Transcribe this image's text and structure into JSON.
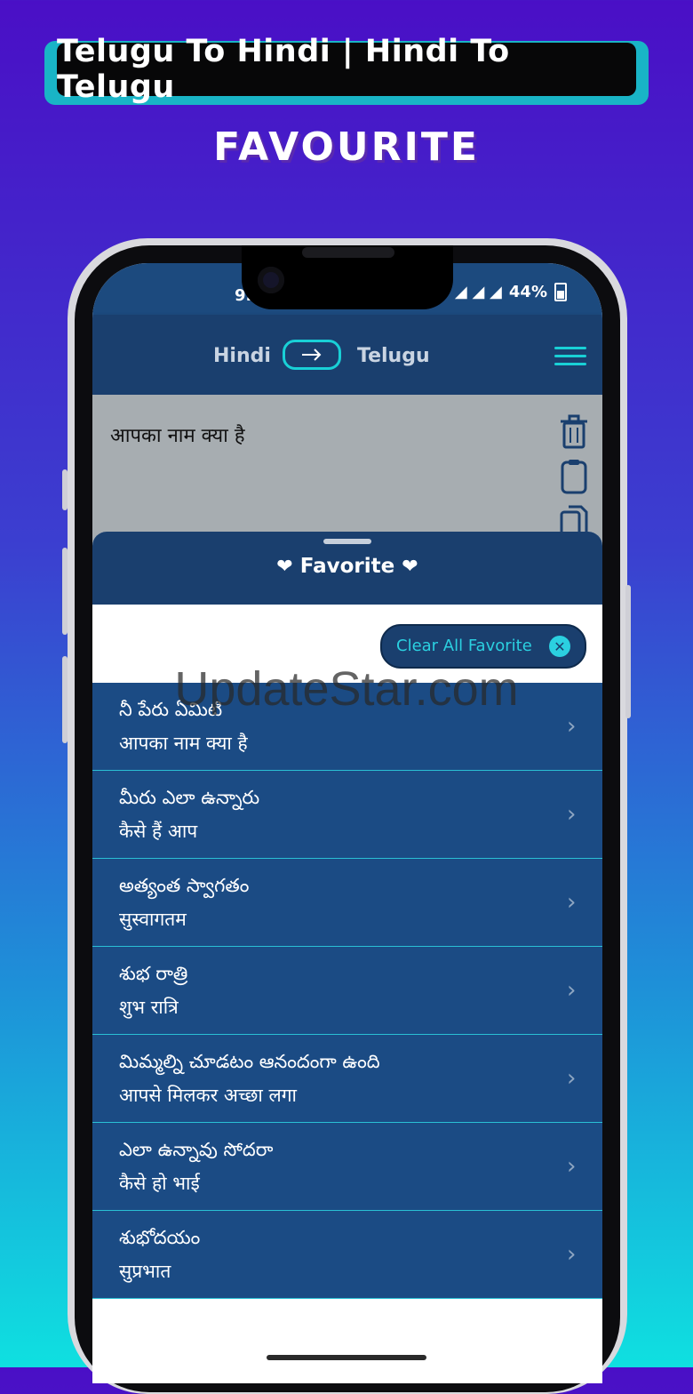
{
  "banner": {
    "title": "Telugu To Hindi | Hindi To Telugu"
  },
  "heading": "FAVOURITE",
  "status_bar": {
    "time": "9.",
    "battery": "44%"
  },
  "app_bar": {
    "from_lang": "Hindi",
    "to_lang": "Telugu",
    "swap_icon": "arrow-right-icon",
    "menu_icon": "hamburger-menu-icon"
  },
  "input": {
    "text": "आपका नाम क्या है",
    "icons": [
      "trash-icon",
      "clipboard-icon",
      "copy-icon"
    ]
  },
  "sheet": {
    "title": "Favorite",
    "clear_label": "Clear All Favorite"
  },
  "favorites": [
    {
      "telugu": "నీ పేరు ఏమిటి",
      "hindi": "आपका नाम क्या है"
    },
    {
      "telugu": "మీరు ఎలా ఉన్నారు",
      "hindi": "कैसे हैं आप"
    },
    {
      "telugu": "అత్యంత స్వాగతం",
      "hindi": "सुस्वागतम"
    },
    {
      "telugu": "శుభ రాత్రి",
      "hindi": "शुभ रात्रि"
    },
    {
      "telugu": "మిమ్మల్ని చూడటం ఆనందంగా ఉంది",
      "hindi": "आपसे मिलकर अच्छा लगा"
    },
    {
      "telugu": "ఎలా ఉన్నావు సోదరా",
      "hindi": "कैसे हो भाई"
    },
    {
      "telugu": "శుభోదయం",
      "hindi": "सुप्रभात"
    }
  ],
  "watermark": "UpdateStar.com",
  "colors": {
    "app_bar": "#1a3f6e",
    "accent": "#19d0d6",
    "list_row": "#1b4b84"
  }
}
